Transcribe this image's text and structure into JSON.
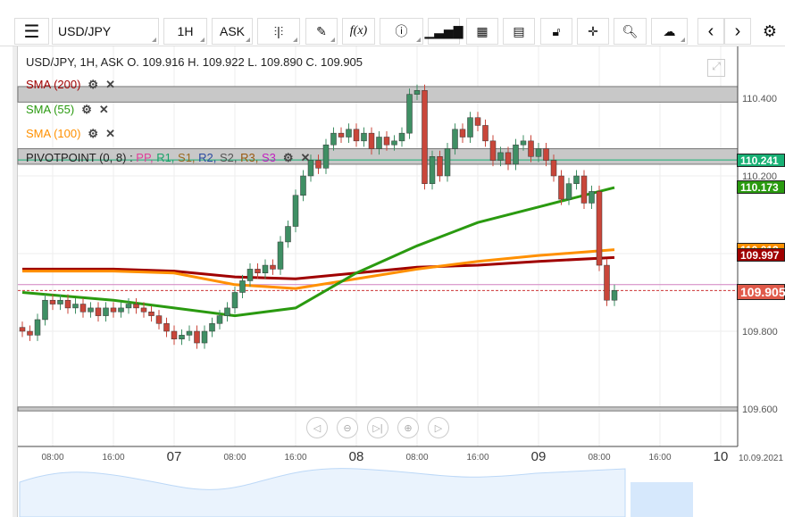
{
  "toolbar": {
    "symbol": "USD/JPY",
    "interval": "1H",
    "price_type": "ASK",
    "fx_label": "f(x)"
  },
  "legend": {
    "ohlc": "USD/JPY, 1H, ASK   O. 109.916 H. 109.922 L. 109.890 C. 109.905",
    "sma200": "SMA (200)",
    "sma55": "SMA (55)",
    "sma100": "SMA (100)",
    "pivot": "PIVOTPOINT (0, 8)",
    "pivot_levels": [
      "PP",
      "R1",
      "S1",
      "R2",
      "S2",
      "R3",
      "S3"
    ],
    "pivot_colors": [
      "#e0409a",
      "#1aa36a",
      "#9a6a20",
      "#2a4aa0",
      "#555555",
      "#9a5a10",
      "#c020c0"
    ]
  },
  "colors": {
    "up": "#3f8f64",
    "down": "#c9463a",
    "sma200": "#a00000",
    "sma55": "#2a9a10",
    "sma100": "#ff9000",
    "last": "#e05a4a",
    "pivot_tag": "#18b074"
  },
  "price_axis": {
    "ticks": [
      "110.400",
      "110.200",
      "109.800",
      "109.600"
    ],
    "tags": {
      "pivot": "110.241",
      "sma55": "110.173",
      "sma100": "110.012",
      "sma200": "109.997",
      "last": "109.905"
    }
  },
  "time_axis": {
    "labels": [
      {
        "t": 4,
        "text": "08:00"
      },
      {
        "t": 12,
        "text": "16:00"
      },
      {
        "t": 20,
        "text": "07",
        "day": true
      },
      {
        "t": 28,
        "text": "08:00"
      },
      {
        "t": 36,
        "text": "16:00"
      },
      {
        "t": 44,
        "text": "08",
        "day": true
      },
      {
        "t": 52,
        "text": "08:00"
      },
      {
        "t": 60,
        "text": "16:00"
      },
      {
        "t": 68,
        "text": "09",
        "day": true
      },
      {
        "t": 76,
        "text": "08:00"
      },
      {
        "t": 84,
        "text": "16:00"
      },
      {
        "t": 92,
        "text": "10",
        "day": true
      }
    ],
    "date": "10.09.2021"
  },
  "chart_data": {
    "type": "candlestick",
    "ylim": [
      109.57,
      110.52
    ],
    "start": "06 04:00",
    "interval_hours": 1,
    "closes": [
      109.8,
      109.79,
      109.83,
      109.88,
      109.87,
      109.88,
      109.86,
      109.87,
      109.85,
      109.86,
      109.84,
      109.86,
      109.85,
      109.86,
      109.87,
      109.86,
      109.85,
      109.84,
      109.82,
      109.8,
      109.78,
      109.79,
      109.8,
      109.77,
      109.8,
      109.82,
      109.84,
      109.86,
      109.9,
      109.93,
      109.96,
      109.95,
      109.97,
      109.96,
      110.03,
      110.07,
      110.15,
      110.2,
      110.24,
      110.22,
      110.28,
      110.31,
      110.3,
      110.32,
      110.29,
      110.31,
      110.27,
      110.3,
      110.28,
      110.29,
      110.31,
      110.41,
      110.42,
      110.18,
      110.25,
      110.2,
      110.27,
      110.32,
      110.3,
      110.35,
      110.33,
      110.29,
      110.24,
      110.26,
      110.23,
      110.28,
      110.29,
      110.25,
      110.27,
      110.24,
      110.2,
      110.14,
      110.18,
      110.2,
      110.13,
      110.16,
      109.97,
      109.88,
      109.905
    ],
    "sma": {
      "idx": [
        0,
        12,
        20,
        28,
        36,
        44,
        52,
        60,
        68,
        78
      ],
      "sma200": [
        109.96,
        109.96,
        109.955,
        109.94,
        109.935,
        109.95,
        109.965,
        109.97,
        109.98,
        109.99
      ],
      "sma55": [
        109.9,
        109.88,
        109.86,
        109.84,
        109.86,
        109.95,
        110.02,
        110.08,
        110.12,
        110.17
      ],
      "sma100": [
        109.955,
        109.955,
        109.95,
        109.92,
        109.91,
        109.935,
        109.96,
        109.98,
        109.995,
        110.01
      ]
    },
    "bands": [
      [
        110.39,
        110.43
      ],
      [
        110.23,
        110.27
      ],
      [
        109.595,
        109.605
      ]
    ]
  }
}
